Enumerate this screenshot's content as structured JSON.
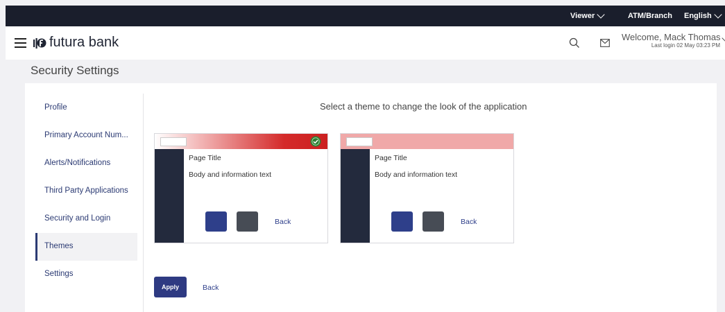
{
  "topbar": {
    "viewer": "Viewer",
    "atm_branch": "ATM/Branch",
    "language": "English"
  },
  "header": {
    "brand": "futura bank",
    "welcome": "Welcome, Mack Thomas",
    "last_login": "Last login 02 May 03:23 PM",
    "icons": [
      "menu-icon",
      "search-icon",
      "mail-icon",
      "chevron-down-icon"
    ]
  },
  "page_title": "Security Settings",
  "sidebar": {
    "items": [
      {
        "label": "Profile"
      },
      {
        "label": "Primary Account Num..."
      },
      {
        "label": "Alerts/Notifications"
      },
      {
        "label": "Third Party Applications"
      },
      {
        "label": "Security and Login"
      },
      {
        "label": "Themes",
        "active": true
      },
      {
        "label": "Settings"
      }
    ]
  },
  "main": {
    "instruction": "Select a theme to change the look of the application",
    "themes": [
      {
        "page_title": "Page Title",
        "body_text": "Body and information text",
        "back": "Back",
        "selected": true,
        "accent": "#d42a2a"
      },
      {
        "page_title": "Page Title",
        "body_text": "Body and information text",
        "back": "Back",
        "selected": false,
        "accent": "#f0a8a8"
      }
    ],
    "apply_label": "Apply",
    "back_label": "Back"
  },
  "colors": {
    "topbar_bg": "#1a1e2c",
    "primary": "#2e3a82",
    "sidebar_dark": "#232a3d",
    "selected_check": "#2e7d32"
  }
}
